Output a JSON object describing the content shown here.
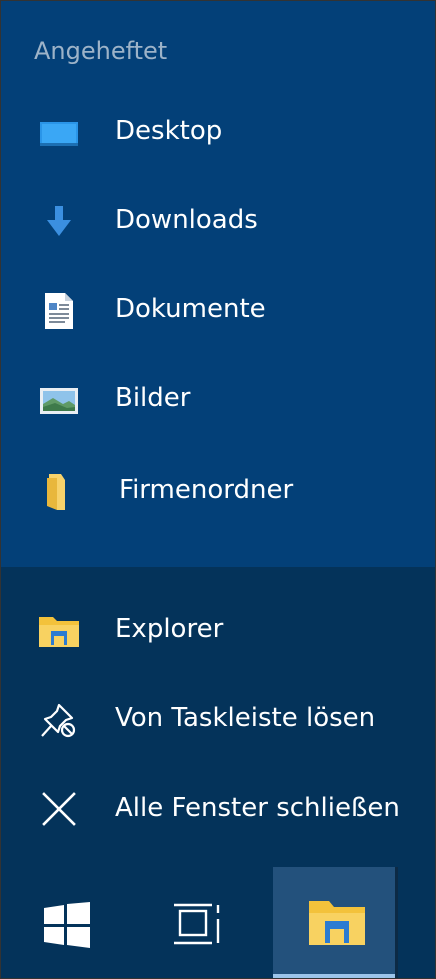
{
  "jumplist": {
    "section_title": "Angeheftet",
    "pinned": [
      {
        "label": "Desktop",
        "icon": "desktop-icon"
      },
      {
        "label": "Downloads",
        "icon": "downloads-arrow-icon"
      },
      {
        "label": "Dokumente",
        "icon": "documents-icon"
      },
      {
        "label": "Bilder",
        "icon": "pictures-icon"
      },
      {
        "label": "Firmenordner",
        "icon": "folder-icon"
      }
    ],
    "actions": [
      {
        "label": "Explorer",
        "icon": "file-explorer-icon"
      },
      {
        "label": "Von Taskleiste lösen",
        "icon": "unpin-icon"
      },
      {
        "label": "Alle Fenster schließen",
        "icon": "close-icon"
      }
    ]
  },
  "taskbar": {
    "buttons": [
      {
        "name": "start",
        "icon": "windows-logo-icon"
      },
      {
        "name": "task-view",
        "icon": "task-view-icon"
      },
      {
        "name": "file-explorer",
        "icon": "file-explorer-icon",
        "active": true
      }
    ]
  },
  "colors": {
    "pinned_bg": "#034078",
    "actions_bg": "#04335a",
    "active_taskbar_bg": "#23517c",
    "active_indicator": "#9cc4ea",
    "section_title": "#9db3c8"
  }
}
